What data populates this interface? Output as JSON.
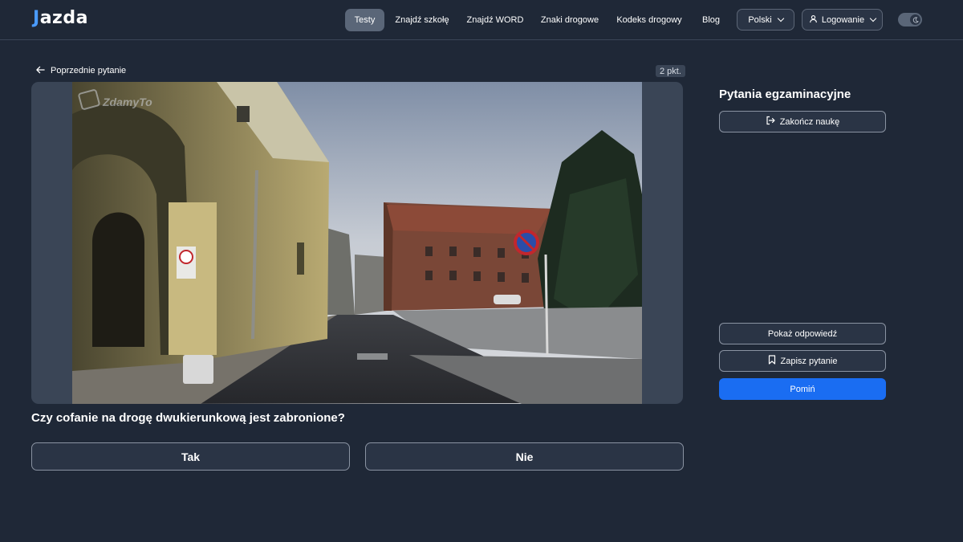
{
  "header": {
    "logo_mark": "J",
    "logo_text": "azda",
    "nav": [
      {
        "label": "Testy",
        "active": true
      },
      {
        "label": "Znajdź szkołę"
      },
      {
        "label": "Znajdź WORD"
      },
      {
        "label": "Znaki drogowe"
      },
      {
        "label": "Kodeks drogowy"
      },
      {
        "label": "Blog"
      }
    ],
    "language": "Polski",
    "login": "Logowanie",
    "theme_toggle_icon": "moon-icon"
  },
  "question": {
    "back_label": "Poprzednie pytanie",
    "points": "2 pkt.",
    "media_watermark": "ZdamyTo",
    "text": "Czy cofanie na drogę dwukierunkową jest zabronione?",
    "answers": [
      "Tak",
      "Nie"
    ]
  },
  "sidebar": {
    "title": "Pytania egzaminacyjne",
    "finish_label": "Zakończ naukę",
    "show_answer_label": "Pokaż odpowiedź",
    "save_label": "Zapisz pytanie",
    "skip_label": "Pomiń"
  },
  "colors": {
    "background": "#1f2837",
    "panel": "#3a4556",
    "accent": "#1a6df2",
    "logo_accent": "#4a9bff"
  }
}
